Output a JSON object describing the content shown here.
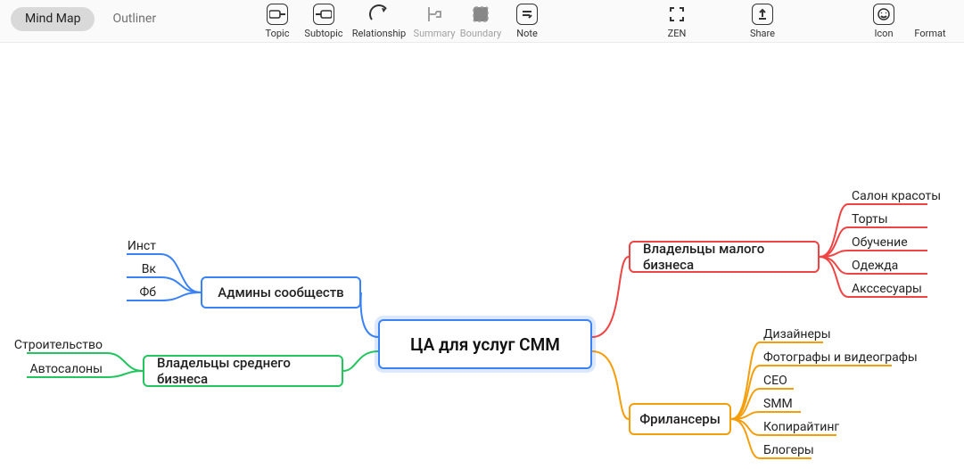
{
  "toolbar": {
    "tabs": {
      "mindmap": "Mind Map",
      "outliner": "Outliner"
    },
    "tools": {
      "topic": "Topic",
      "subtopic": "Subtopic",
      "relationship": "Relationship",
      "summary": "Summary",
      "boundary": "Boundary",
      "note": "Note",
      "zen": "ZEN",
      "share": "Share",
      "icon": "Icon",
      "format": "Format"
    }
  },
  "map": {
    "central": "ЦА для услуг СММ",
    "admins": {
      "label": "Админы сообществ",
      "children": [
        "Инст",
        "Вк",
        "Фб"
      ]
    },
    "midbiz": {
      "label": "Владельцы среднего бизнеса",
      "children": [
        "Строительство",
        "Автосалоны"
      ]
    },
    "smallbiz": {
      "label": "Владельцы малого бизнеса",
      "children": [
        "Салон красоты",
        "Торты",
        "Обучение",
        "Одежда",
        "Акссесуары"
      ]
    },
    "freelancers": {
      "label": "Фрилансеры",
      "children": [
        "Дизайнеры",
        "Фотографы и видеографы",
        "CEO",
        "SMM",
        "Копирайтинг",
        "Блогеры"
      ]
    }
  }
}
